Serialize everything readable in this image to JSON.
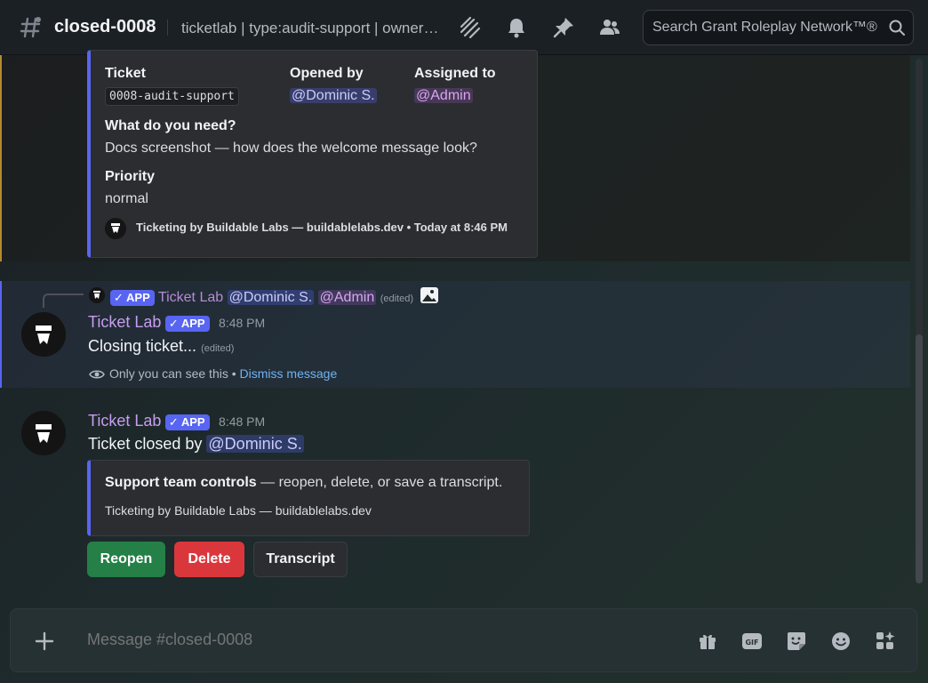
{
  "header": {
    "channel_name": "closed-0008",
    "topic": "ticketlab | type:audit-support | owner:Dominic S.",
    "search_placeholder": "Search Grant Roleplay Network™®"
  },
  "ticket_embed": {
    "fields": {
      "ticket_label": "Ticket",
      "ticket_value": "0008-audit-support",
      "opened_by_label": "Opened by",
      "opened_by_value": "@Dominic S.",
      "assigned_to_label": "Assigned to",
      "assigned_to_value": "@Admin",
      "need_label": "What do you need?",
      "need_value": "Docs screenshot — how does the welcome message look?",
      "priority_label": "Priority",
      "priority_value": "normal"
    },
    "footer": "Ticketing by Buildable Labs — buildablelabs.dev • Today at 8:46 PM"
  },
  "reply_preview": {
    "app_tag": "✓ APP",
    "author": "Ticket Lab",
    "mention_user": "@Dominic S.",
    "mention_role": "@Admin",
    "edited": "(edited)"
  },
  "message1": {
    "author": "Ticket Lab",
    "app_tag": "✓ APP",
    "time": "8:48 PM",
    "text": "Closing ticket...",
    "edited": "(edited)",
    "ephemeral_note": "Only you can see this",
    "separator": "•",
    "dismiss": "Dismiss message"
  },
  "message2": {
    "author": "Ticket Lab",
    "app_tag": "✓ APP",
    "time": "8:48 PM",
    "text_prefix": "Ticket closed by",
    "mention_user": "@Dominic S.",
    "embed_title_bold": "Support team controls",
    "embed_title_rest": " — reopen, delete, or save a transcript.",
    "embed_footer": "Ticketing by Buildable Labs — buildablelabs.dev",
    "buttons": {
      "reopen": "Reopen",
      "delete": "Delete",
      "transcript": "Transcript"
    }
  },
  "composer": {
    "placeholder": "Message #closed-0008"
  },
  "icons": {
    "channel": "hashtag-icon",
    "threads": "threads-icon",
    "notifications": "bell-icon",
    "pins": "pin-icon",
    "members": "members-icon",
    "search": "search-icon",
    "attach": "plus-icon",
    "gift": "gift-icon",
    "gif": "gif-icon",
    "sticker": "sticker-icon",
    "emoji": "emoji-icon",
    "apps": "apps-icon"
  },
  "colors": {
    "blurple": "#5865f2",
    "success": "#248046",
    "danger": "#da373c",
    "author": "#c79df0",
    "link": "#6fb3f2"
  }
}
